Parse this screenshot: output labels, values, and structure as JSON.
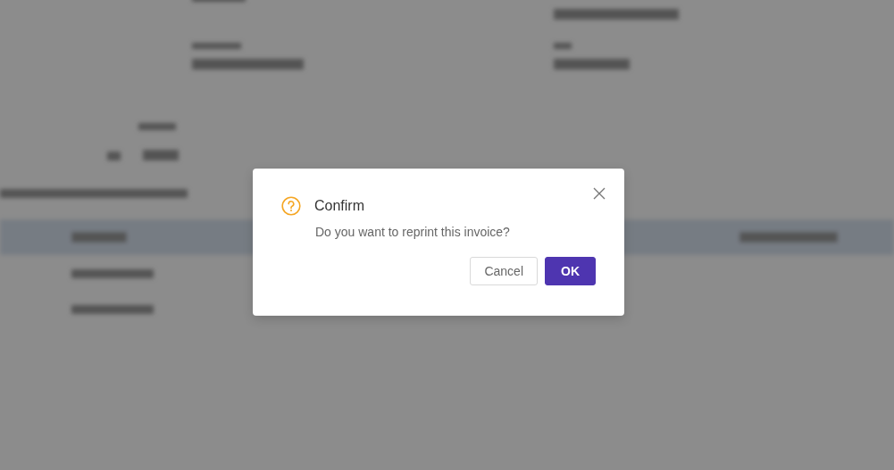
{
  "dialog": {
    "title": "Confirm",
    "message": "Do you want to reprint this invoice?",
    "buttons": [
      {
        "label": "Cancel",
        "kind": "secondary"
      },
      {
        "label": "OK",
        "kind": "primary"
      }
    ]
  }
}
